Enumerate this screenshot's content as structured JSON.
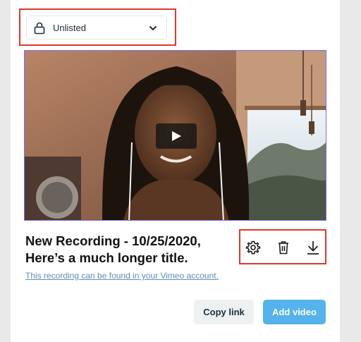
{
  "privacy": {
    "selected": "Unlisted",
    "icon": "lock-icon"
  },
  "video": {
    "play_icon": "play-icon",
    "accent_border": "#7b6cf2"
  },
  "recording": {
    "title_line1": "New Recording - 10/25/2020,",
    "title_line2": "Here’s a much longer title.",
    "link_text": "This recording can be found in your Vimeo account."
  },
  "actions": {
    "settings_icon": "gear-icon",
    "delete_icon": "trash-icon",
    "download_icon": "download-icon"
  },
  "buttons": {
    "copy_link": "Copy link",
    "add_video": "Add video"
  },
  "colors": {
    "highlight": "#e0362c",
    "primary": "#54b3ec",
    "link": "#5d8fb5"
  }
}
